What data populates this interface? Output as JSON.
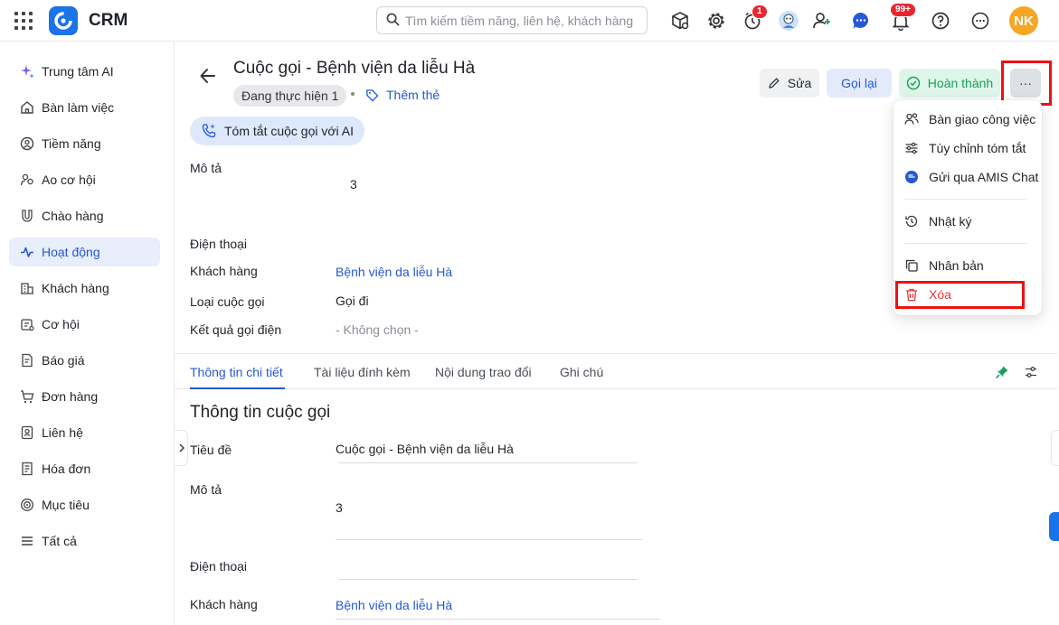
{
  "app": {
    "title": "CRM"
  },
  "search": {
    "placeholder": "Tìm kiếm tiềm năng, liên hệ, khách hàng"
  },
  "header": {
    "timer_badge": "1",
    "notification_badge": "99+",
    "user_initials": "NK"
  },
  "sidebar": {
    "items": [
      {
        "label": "Trung tâm AI"
      },
      {
        "label": "Bàn làm việc"
      },
      {
        "label": "Tiềm năng"
      },
      {
        "label": "Ao cơ hội"
      },
      {
        "label": "Chào hàng"
      },
      {
        "label": "Hoạt động"
      },
      {
        "label": "Khách hàng"
      },
      {
        "label": "Cơ hội"
      },
      {
        "label": "Báo giá"
      },
      {
        "label": "Đơn hàng"
      },
      {
        "label": "Liên hệ"
      },
      {
        "label": "Hóa đơn"
      },
      {
        "label": "Mục tiêu"
      },
      {
        "label": "Tất cả"
      }
    ],
    "active_index": 5
  },
  "record": {
    "title": "Cuộc gọi - Bệnh viện da liễu Hà",
    "status": "Đang thực hiện 1",
    "add_tag": "Thêm thẻ"
  },
  "actions": {
    "edit": "Sửa",
    "call_back": "Gọi lại",
    "complete": "Hoàn thành",
    "more": "···"
  },
  "ai_button": "Tóm tắt cuộc gọi với AI",
  "summary_fields": {
    "description_label": "Mô tả",
    "description_value": "3",
    "phone_label": "Điện thoại",
    "customer_label": "Khách hàng",
    "customer_value": "Bệnh viện da liễu Hà",
    "call_type_label": "Loại cuộc gọi",
    "call_type_value": "Gọi đi",
    "call_result_label": "Kết quả gọi điện",
    "call_result_value": "- Không chọn -"
  },
  "tabs": [
    {
      "label": "Thông tin chi tiết"
    },
    {
      "label": "Tài liệu đính kèm"
    },
    {
      "label": "Nội dung trao đổi"
    },
    {
      "label": "Ghi chú"
    }
  ],
  "detail": {
    "section_title": "Thông tin cuộc gọi",
    "subject_label": "Tiêu đề",
    "subject_value": "Cuộc gọi - Bệnh viện da liễu Hà",
    "description_label": "Mô tả",
    "description_value": "3",
    "phone_label": "Điện thoại",
    "customer_label": "Khách hàng",
    "customer_value": "Bệnh viện da liễu Hà"
  },
  "more_menu": {
    "items": [
      {
        "label": "Bàn giao công việc"
      },
      {
        "label": "Tùy chỉnh tóm tắt"
      },
      {
        "label": "Gửi qua AMIS Chat"
      },
      {
        "label": "Nhật ký"
      },
      {
        "label": "Nhân bản"
      },
      {
        "label": "Xóa"
      }
    ]
  },
  "colors": {
    "accent": "#2458d6",
    "success": "#1aa15b",
    "danger": "#e5383b",
    "highlight_border": "#ee1111"
  }
}
